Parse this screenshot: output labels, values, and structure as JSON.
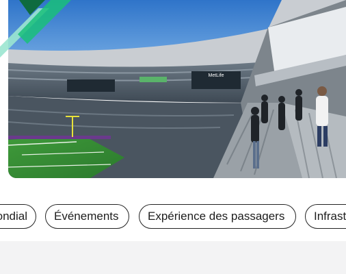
{
  "hero": {
    "image_alt": "",
    "scoreboard_text": "MetLife"
  },
  "tags": [
    {
      "label": "Mondial"
    },
    {
      "label": "Événements"
    },
    {
      "label": "Expérience des passagers"
    },
    {
      "label": "Infrastructures"
    }
  ],
  "colors": {
    "accent_green": "#1ac07a",
    "accent_teal": "#9be6d0",
    "page_background": "#f3f3f4",
    "tag_border": "#232323"
  }
}
